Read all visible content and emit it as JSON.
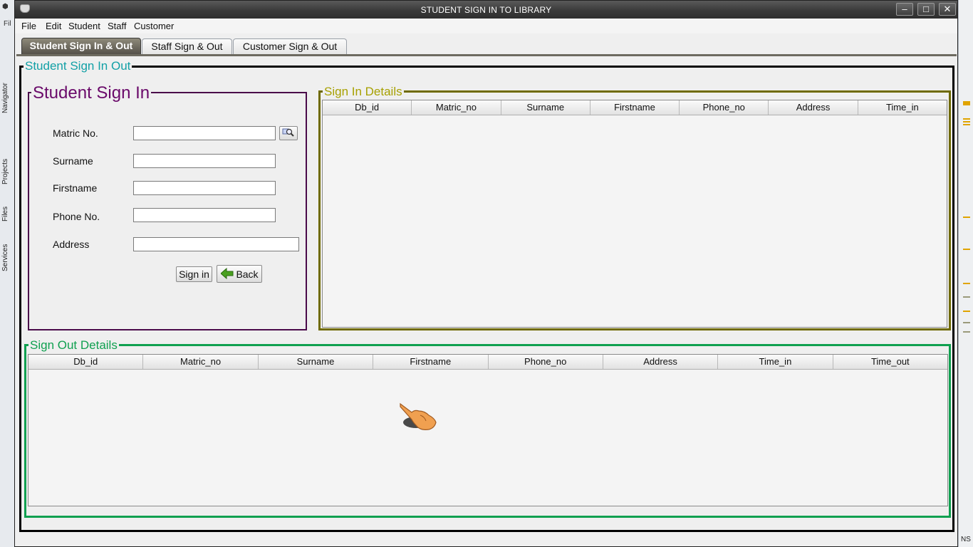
{
  "window": {
    "title": "STUDENT SIGN IN TO LIBRARY",
    "controls": [
      "minimize",
      "maximize",
      "close"
    ]
  },
  "menubar": {
    "items": [
      "File",
      "Edit",
      "Student",
      "Staff",
      "Customer"
    ]
  },
  "tabs": [
    {
      "label": "Student Sign In & Out",
      "active": true
    },
    {
      "label": "Staff Sign & Out",
      "active": false
    },
    {
      "label": "Customer Sign & Out",
      "active": false
    }
  ],
  "panel": {
    "title": "Student Sign In Out",
    "sign_in_form": {
      "title": "Student Sign In",
      "fields": [
        {
          "label": "Matric No.",
          "value": ""
        },
        {
          "label": "Surname",
          "value": ""
        },
        {
          "label": "Firstname",
          "value": ""
        },
        {
          "label": "Phone No.",
          "value": ""
        },
        {
          "label": "Address",
          "value": ""
        }
      ],
      "sign_in_button": "Sign in",
      "back_button": "Back"
    },
    "sign_in_details": {
      "title": "Sign In Details",
      "columns": [
        "Db_id",
        "Matric_no",
        "Surname",
        "Firstname",
        "Phone_no",
        "Address",
        "Time_in"
      ],
      "rows": []
    },
    "sign_out_details": {
      "title": "Sign Out Details",
      "columns": [
        "Db_id",
        "Matric_no",
        "Surname",
        "Firstname",
        "Phone_no",
        "Address",
        "Time_in",
        "Time_out"
      ],
      "rows": []
    }
  },
  "ide_background": {
    "left_tabs": [
      "Navigator",
      "Projects",
      "Files",
      "Services"
    ],
    "left_menu_fragment": "Fil",
    "bottom_right_fragment": "NS"
  },
  "colors": {
    "outer_title": "#12a0a6",
    "sign_in_title": "#6a0a6a",
    "sign_in_details_border": "#6f6a00",
    "sign_out_details_border": "#10a050"
  }
}
